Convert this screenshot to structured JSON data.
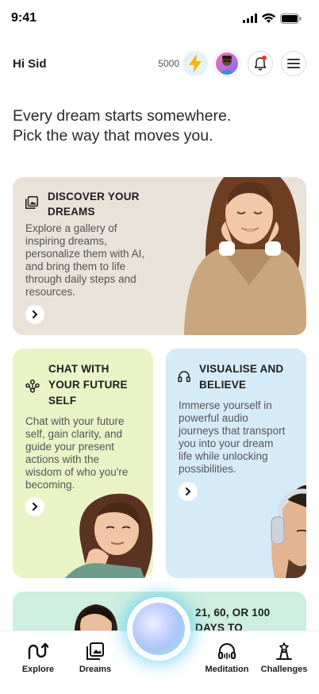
{
  "status_bar": {
    "time": "9:41"
  },
  "header": {
    "greeting": "Hi Sid",
    "points": "5000"
  },
  "headline": {
    "line1": "Every dream starts somewhere.",
    "line2": "Pick the way that moves you."
  },
  "cards": {
    "discover": {
      "title_line1": "DISCOVER YOUR",
      "title_line2": "DREAMS",
      "desc": [
        "Explore a gallery of",
        "inspiring dreams,",
        "personalize them with AI,",
        "and bring them to life",
        "through daily steps and",
        "resources."
      ]
    },
    "chat": {
      "title_line1": "CHAT WITH",
      "title_line2": "YOUR FUTURE",
      "title_line3": "SELF",
      "desc": [
        "Chat with your future",
        "self, gain clarity, and",
        "guide your present",
        "actions with the",
        "wisdom of who you're",
        "becoming."
      ]
    },
    "visualise": {
      "title_line1": "VISUALISE AND",
      "title_line2": "BELIEVE",
      "desc": [
        "Immerse yourself in",
        "powerful audio",
        "journeys that transport",
        "you into your dream",
        "life while unlocking",
        "possibilities."
      ]
    },
    "challenge": {
      "title_line1": "21, 60, OR 100",
      "title_line2": "DAYS TO"
    }
  },
  "nav": {
    "explore": "Explore",
    "dreams": "Dreams",
    "meditation": "Meditation",
    "challenges": "Challenges"
  },
  "icons": {
    "signal": "signal-icon",
    "wifi": "wifi-icon",
    "battery": "battery-icon",
    "bolt": "lightning-bolt-icon",
    "bell": "bell-icon",
    "menu": "hamburger-menu-icon",
    "gallery": "gallery-icon",
    "chat": "network-chat-icon",
    "headphones": "headphones-icon",
    "arrow": "chevron-right-icon"
  },
  "colors": {
    "discover_bg": "#e8e2d9",
    "chat_bg": "#eaf3c6",
    "visualise_bg": "#d6ebf8",
    "challenge_bg": "#cdeee0",
    "bolt": "#f5b800",
    "notification": "#e53935"
  }
}
